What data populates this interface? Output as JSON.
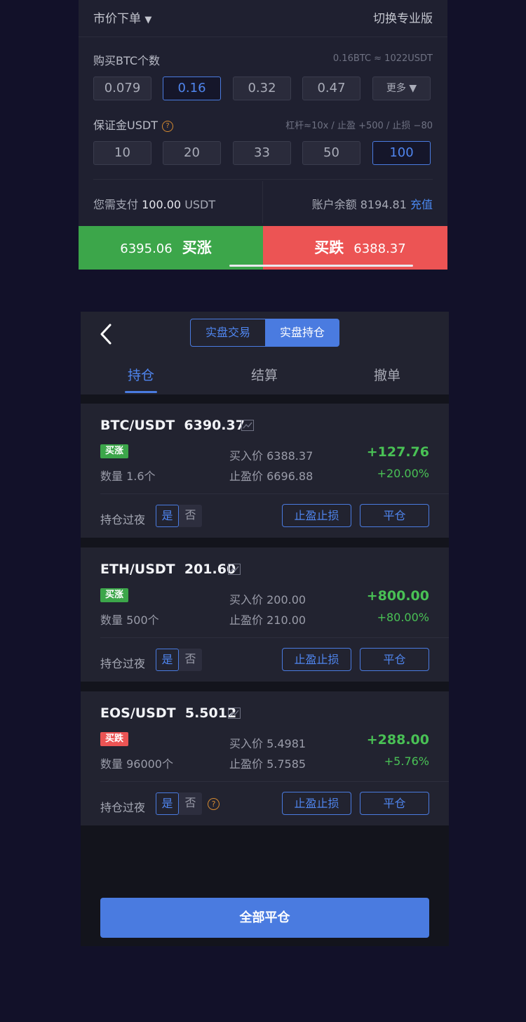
{
  "order_panel": {
    "order_type": "市价下单",
    "dropdown_arrow": "▼",
    "switch_pro": "切换专业版",
    "quantity_label": "购买BTC个数",
    "quantity_hint": "0.16BTC ≈ 1022USDT",
    "quantity_options": [
      "0.079",
      "0.16",
      "0.32",
      "0.47"
    ],
    "quantity_more": "更多 ▼",
    "margin_label": "保证金USDT",
    "margin_help": "?",
    "margin_hint": "杠杆≈10x / 止盈 +500 / 止损 −80",
    "margin_options": [
      "10",
      "20",
      "33",
      "50",
      "100"
    ],
    "pay_prefix": "您需支付",
    "pay_amount": "100.00",
    "pay_unit": "USDT",
    "balance_label": "账户余额",
    "balance_value": "8194.81",
    "recharge": "充值",
    "buy_up_price": "6395.06",
    "buy_up_label": "买涨",
    "buy_down_label": "买跌",
    "buy_down_price": "6388.37",
    "colors": {
      "green": "#3ca64a",
      "red": "#ec5454",
      "accent": "#4a7be0"
    }
  },
  "positions_panel": {
    "back_icon": "chevron-left-icon",
    "segment": [
      "实盘交易",
      "实盘持仓"
    ],
    "tabs": [
      "持仓",
      "结算",
      "撤单"
    ],
    "positions": [
      {
        "pair": "BTC/USDT",
        "price": "6390.37",
        "direction": "买涨",
        "quantity": "数量 1.6个",
        "entry": "买入价 6388.37",
        "take_profit": "止盈价 6696.88",
        "pnl": "+127.76",
        "pnl_pct": "+20.00%",
        "overnight_label": "持仓过夜",
        "yes": "是",
        "no": "否",
        "tpsl_button": "止盈止损",
        "close_button": "平仓"
      },
      {
        "pair": "ETH/USDT",
        "price": "201.60",
        "direction": "买涨",
        "quantity": "数量 500个",
        "entry": "买入价 200.00",
        "take_profit": "止盈价 210.00",
        "pnl": "+800.00",
        "pnl_pct": "+80.00%",
        "overnight_label": "持仓过夜",
        "yes": "是",
        "no": "否",
        "tpsl_button": "止盈止损",
        "close_button": "平仓"
      },
      {
        "pair": "EOS/USDT",
        "price": "5.5012",
        "direction": "买跌",
        "quantity": "数量 96000个",
        "entry": "买入价 5.4981",
        "take_profit": "止盈价 5.7585",
        "pnl": "+288.00",
        "pnl_pct": "+5.76%",
        "overnight_label": "持仓过夜",
        "yes": "是",
        "no": "否",
        "help": "?",
        "tpsl_button": "止盈止损",
        "close_button": "平仓"
      }
    ],
    "close_all": "全部平仓"
  }
}
